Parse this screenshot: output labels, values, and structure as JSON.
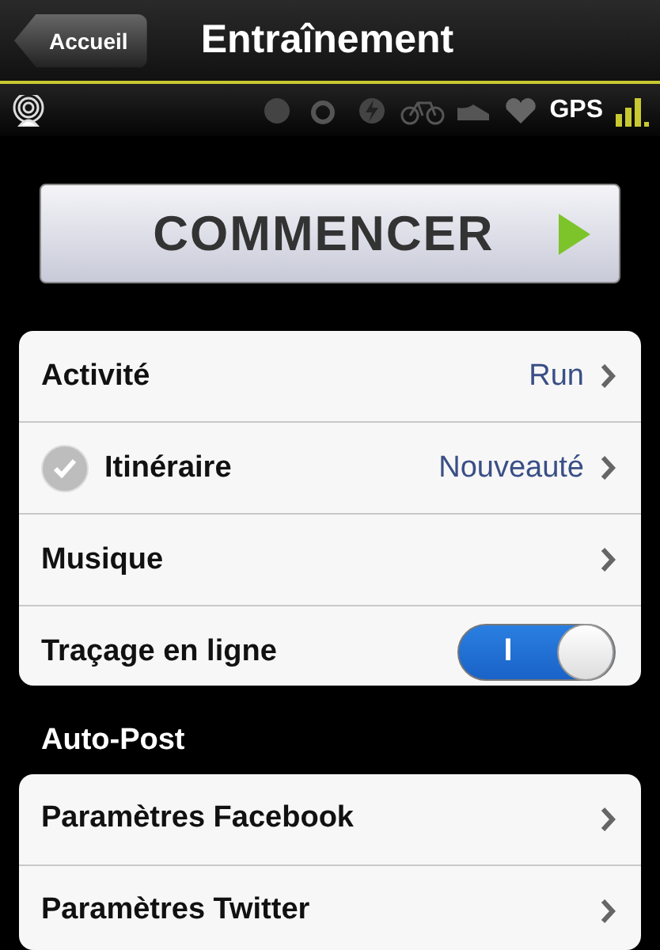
{
  "nav": {
    "back": "Accueil",
    "title": "Entraînement"
  },
  "status": {
    "gps": "GPS"
  },
  "start_button": {
    "label": "COMMENCER"
  },
  "settings": [
    {
      "kind": "link",
      "label": "Activité",
      "value": "Run"
    },
    {
      "kind": "link",
      "label": "Itinéraire",
      "value": "Nouveauté",
      "checked": true
    },
    {
      "kind": "link",
      "label": "Musique"
    },
    {
      "kind": "toggle",
      "label": "Traçage en ligne",
      "on": true,
      "on_text": "I"
    }
  ],
  "auto_post": {
    "header": "Auto-Post",
    "items": [
      {
        "kind": "link",
        "label": "Paramètres Facebook"
      },
      {
        "kind": "link",
        "label": "Paramètres Twitter"
      }
    ]
  }
}
